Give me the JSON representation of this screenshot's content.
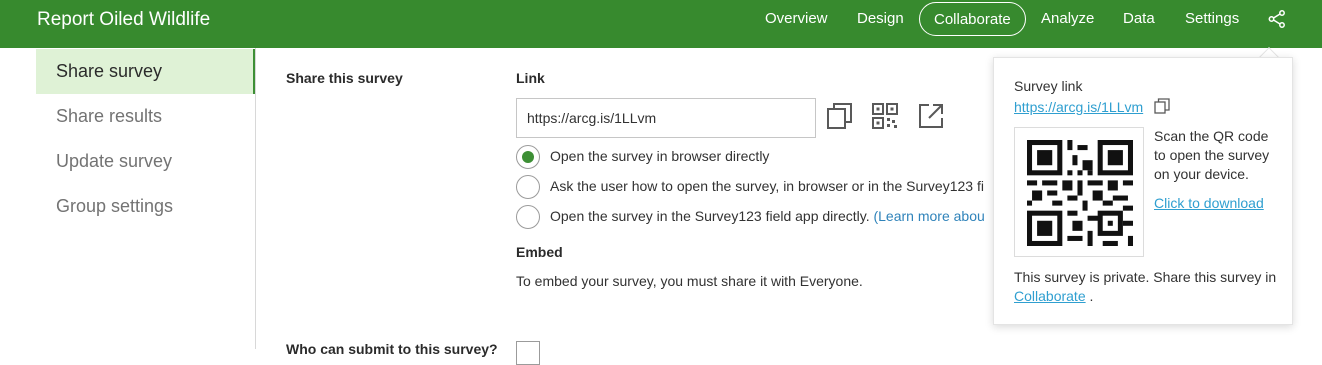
{
  "header": {
    "title": "Report Oiled Wildlife",
    "nav": [
      "Overview",
      "Design",
      "Collaborate",
      "Analyze",
      "Data",
      "Settings"
    ],
    "active_nav": "Collaborate",
    "share_icon": "share-icon"
  },
  "sidebar": {
    "items": [
      {
        "label": "Share survey",
        "active": true
      },
      {
        "label": "Share results",
        "active": false
      },
      {
        "label": "Update survey",
        "active": false
      },
      {
        "label": "Group settings",
        "active": false
      }
    ]
  },
  "main": {
    "share_heading": "Share this survey",
    "link_label": "Link",
    "link_value": "https://arcg.is/1LLvm",
    "icons": {
      "copy": "copy-icon",
      "qr": "qr-code-icon",
      "open": "open-external-icon"
    },
    "options": [
      {
        "label": "Open the survey in browser directly",
        "checked": true
      },
      {
        "label": "Ask the user how to open the survey, in browser or in the Survey123 fi",
        "checked": false
      },
      {
        "label": "Open the survey in the Survey123 field app directly.",
        "link": "(Learn more abou",
        "checked": false
      }
    ],
    "embed_label": "Embed",
    "embed_text": "To embed your survey, you must share it with Everyone.",
    "submit_heading": "Who can submit to this survey?"
  },
  "popover": {
    "title": "Survey link",
    "url": "https://arcg.is/1LLvm",
    "scan_text": "Scan the QR code to open the survey on your device.",
    "download_link": "Click to download",
    "private_text": "This survey is private. Share this survey in",
    "collab_link": "Collaborate",
    "period": "."
  },
  "colors": {
    "header": "#378a2e",
    "active_side": "#dff2d6",
    "radio": "#3d8f35",
    "link": "#2f9fd0"
  }
}
